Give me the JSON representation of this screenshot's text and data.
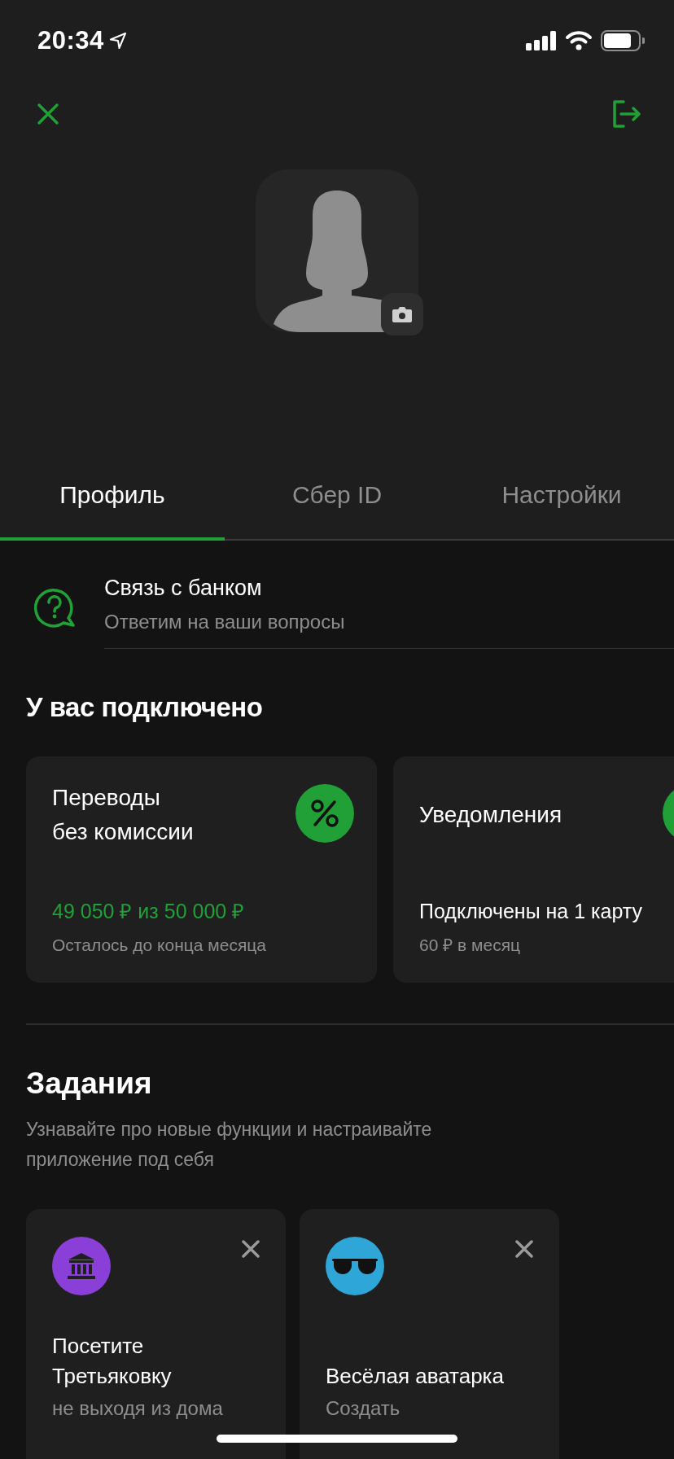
{
  "status_bar": {
    "time": "20:34"
  },
  "tabs": [
    {
      "label": "Профиль",
      "selected": true
    },
    {
      "label": "Сбер ID",
      "selected": false
    },
    {
      "label": "Настройки",
      "selected": false
    }
  ],
  "support": {
    "title": "Связь с банком",
    "subtitle": "Ответим на ваши вопросы"
  },
  "connected": {
    "title": "У вас подключено",
    "cards": [
      {
        "title": "Переводы\nбез комиссии",
        "value": "49 050 ₽ из 50 000 ₽",
        "highlight": true,
        "caption": "Осталось до конца месяца"
      },
      {
        "title": "Уведомления",
        "value": "Подключены на 1 карту",
        "highlight": false,
        "caption": "60 ₽ в месяц"
      }
    ]
  },
  "tasks": {
    "title": "Задания",
    "subtitle": "Узнавайте про новые функции и настраивайте приложение под себя",
    "items": [
      {
        "kind": "museum",
        "color": "#8b3fd9",
        "title": "Посетите\nТретьяковку",
        "subtitle": "не выходя из дома"
      },
      {
        "kind": "glasses",
        "color": "#2ea6d8",
        "title": "Весёлая аватарка",
        "subtitle": "Создать"
      }
    ]
  }
}
